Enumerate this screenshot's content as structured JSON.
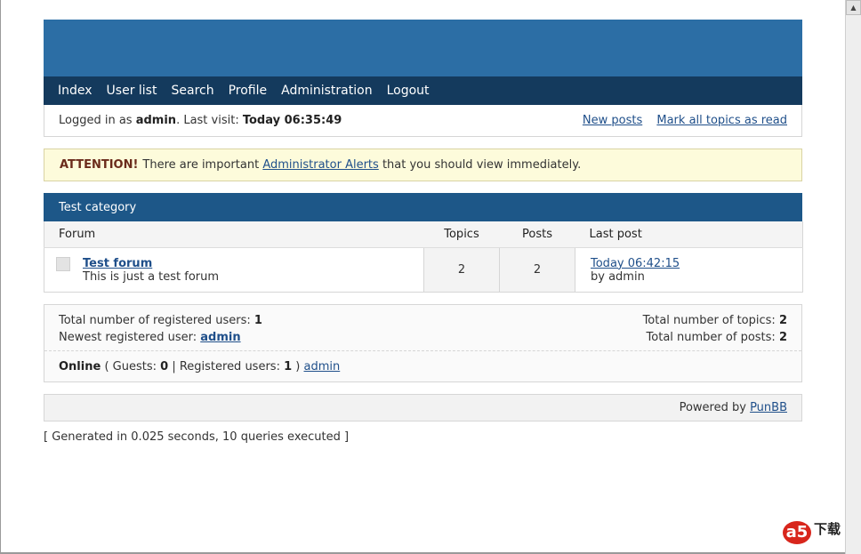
{
  "nav": [
    "Index",
    "User list",
    "Search",
    "Profile",
    "Administration",
    "Logout"
  ],
  "status": {
    "logged_in_prefix": "Logged in as",
    "username": "admin",
    "last_visit_label": ". Last visit:",
    "last_visit_value": "Today 06:35:49",
    "new_posts": "New posts",
    "mark_read": "Mark all topics as read"
  },
  "alert": {
    "attention": "ATTENTION!",
    "pre": "There are important",
    "link": "Administrator Alerts",
    "post": "that you should view immediately."
  },
  "category": {
    "title": "Test category",
    "columns": {
      "forum": "Forum",
      "topics": "Topics",
      "posts": "Posts",
      "last_post": "Last post"
    },
    "rows": [
      {
        "title": "Test forum",
        "desc": "This is just a test forum",
        "topics": "2",
        "posts": "2",
        "last_post_time": "Today 06:42:15",
        "last_post_by": "by admin"
      }
    ]
  },
  "stats": {
    "reg_users_label": "Total number of registered users:",
    "reg_users_value": "1",
    "newest_label": "Newest registered user:",
    "newest_value": "admin",
    "topics_label": "Total number of topics:",
    "topics_value": "2",
    "posts_label": "Total number of posts:",
    "posts_value": "2",
    "online_label": "Online",
    "guests_label": "( Guests:",
    "guests_value": "0",
    "registered_label": "| Registered users:",
    "registered_value": "1",
    "registered_close": ")",
    "online_user": "admin"
  },
  "footer": {
    "powered_by": "Powered by",
    "link": "PunBB"
  },
  "generated": "[ Generated in 0.025 seconds, 10 queries executed ]",
  "watermark": {
    "logo": "a5",
    "text": "下载"
  },
  "scrollbar": {
    "up_arrow": "▲"
  }
}
